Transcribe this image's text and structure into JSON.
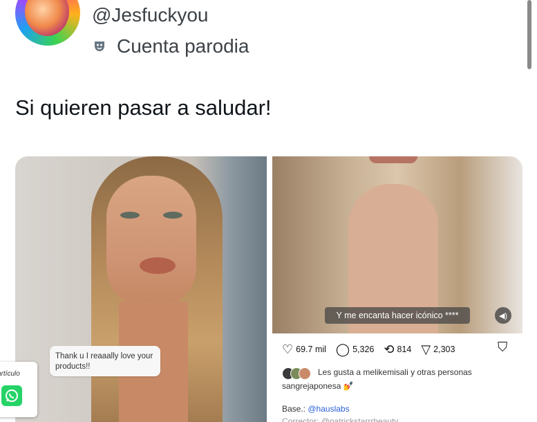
{
  "profile": {
    "handle": "@Jesfuckyou",
    "badge_label": "Cuenta parodia",
    "badge_icon": "theater-mask-icon"
  },
  "tweet": {
    "text": "Si quieren pasar a saludar!"
  },
  "media_left": {
    "comment_bubble": "Thank u I reaaally love your products!!"
  },
  "media_right": {
    "video_caption": "Y me encanta hacer icónico ****",
    "actions": {
      "likes": "69.7 mil",
      "comments": "5,326",
      "reposts": "814",
      "shares": "2,303"
    },
    "liked_by_prefix": "Les gusta a",
    "liked_by_user": "melikemisali",
    "liked_by_suffix": "y otras personas",
    "author": "sangrejaponesa",
    "author_emoji": "💅",
    "base_label": "Base.:",
    "base_link": "@hauslabs",
    "truncated_line": "Corrector: @patrickstarrrbeauty"
  },
  "share_widget": {
    "label": "artículo"
  },
  "colors": {
    "link": "#2b5fd9",
    "whatsapp": "#25d366",
    "text": "#0f1419",
    "secondary_text": "#3c4247"
  }
}
